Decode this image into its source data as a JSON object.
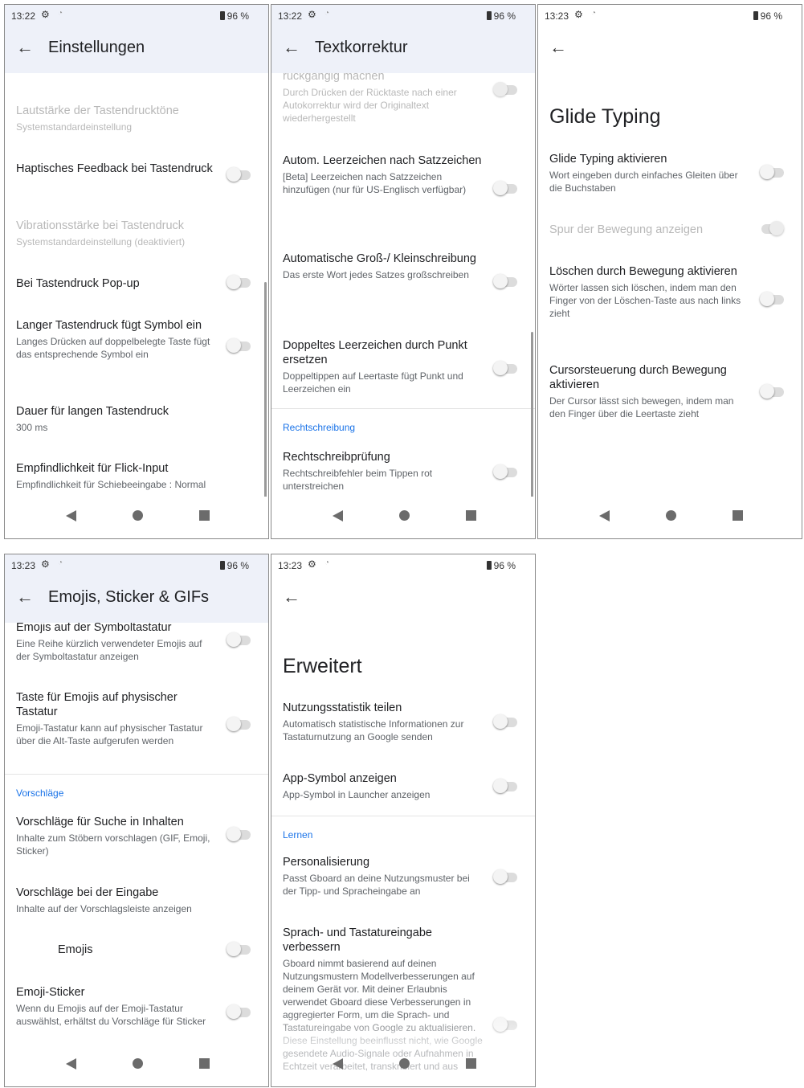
{
  "status": {
    "time_1": "13:22",
    "time_2": "13:22",
    "time_3": "13:23",
    "time_4": "13:23",
    "time_5": "13:23",
    "battery": "96 %"
  },
  "screen1": {
    "title": "Einstellungen",
    "items": [
      {
        "title": "Lautstärke der Tastendrucktöne",
        "subtitle": "Systemstandardeinstellung"
      },
      {
        "title": "Haptisches Feedback bei Tastendruck"
      },
      {
        "title": "Vibrationsstärke bei Tastendruck",
        "subtitle": "Systemstandardeinstellung (deaktiviert)"
      },
      {
        "title": "Bei Tastendruck Pop-up"
      },
      {
        "title": "Langer Tastendruck fügt Symbol ein",
        "subtitle": "Langes Drücken auf doppelbelegte Taste fügt das entsprechende Symbol ein"
      },
      {
        "title": "Dauer für langen Tastendruck",
        "subtitle": "300 ms"
      },
      {
        "title": "Empfindlichkeit für Flick-Input",
        "subtitle": "Empfindlichkeit für Schiebeeingabe : Normal"
      }
    ]
  },
  "screen2": {
    "title": "Textkorrektur",
    "items": [
      {
        "title": "rückgängig machen",
        "subtitle": "Durch Drücken der Rücktaste nach einer Autokorrektur wird der Originaltext wiederhergestellt"
      },
      {
        "title": "Autom. Leerzeichen nach Satzzeichen",
        "subtitle": "[Beta] Leerzeichen nach Satzzeichen hinzufügen (nur für US-Englisch verfügbar)"
      },
      {
        "title": "Automatische Groß-/ Kleinschreibung",
        "subtitle": "Das erste Wort jedes Satzes großschreiben"
      },
      {
        "title": "Doppeltes Leerzeichen durch Punkt ersetzen",
        "subtitle": "Doppeltippen auf Leertaste fügt Punkt und Leerzeichen ein"
      },
      {
        "title": "Rechtschreibprüfung",
        "subtitle": "Rechtschreibfehler beim Tippen rot unterstreichen"
      }
    ],
    "section": "Rechtschreibung"
  },
  "screen3": {
    "title": "Glide Typing",
    "items": [
      {
        "title": "Glide Typing aktivieren",
        "subtitle": "Wort eingeben durch einfaches Gleiten über die Buchstaben"
      },
      {
        "title": "Spur der Bewegung anzeigen"
      },
      {
        "title": "Löschen durch Bewegung aktivieren",
        "subtitle": "Wörter lassen sich löschen, indem man den Finger von der Löschen-Taste aus nach links zieht"
      },
      {
        "title": "Cursorsteuerung durch Bewegung aktivieren",
        "subtitle": "Der Cursor lässt sich bewegen, indem man den Finger über die Leertaste zieht"
      }
    ]
  },
  "screen4": {
    "title": "Emojis, Sticker & GIFs",
    "items": [
      {
        "title": "Emojis auf der Symboltastatur",
        "subtitle": "Eine Reihe kürzlich verwendeter Emojis auf der Symboltastatur anzeigen"
      },
      {
        "title": "Taste für Emojis auf physischer Tastatur",
        "subtitle": "Emoji-Tastatur kann auf physischer Tastatur über die Alt-Taste aufgerufen werden"
      },
      {
        "title": "Vorschläge für Suche in Inhalten",
        "subtitle": "Inhalte zum Stöbern vorschlagen (GIF, Emoji, Sticker)"
      },
      {
        "title": "Vorschläge bei der Eingabe",
        "subtitle": "Inhalte auf der Vorschlagsleiste anzeigen"
      },
      {
        "title": "Emojis"
      },
      {
        "title": "Emoji-Sticker",
        "subtitle": "Wenn du Emojis auf der Emoji-Tastatur auswählst, erhältst du Vorschläge für Sticker"
      }
    ],
    "section": "Vorschläge"
  },
  "screen5": {
    "title": "Erweitert",
    "items": [
      {
        "title": "Nutzungsstatistik teilen",
        "subtitle": "Automatisch statistische Informationen zur Tastaturnutzung an Google senden"
      },
      {
        "title": "App-Symbol anzeigen",
        "subtitle": "App-Symbol in Launcher anzeigen"
      },
      {
        "title": "Personalisierung",
        "subtitle": "Passt Gboard an deine Nutzungsmuster bei der Tipp- und Spracheingabe an"
      },
      {
        "title": "Sprach- und Tastatureingabe verbessern",
        "subtitle": "Gboard nimmt basierend auf deinen Nutzungsmustern Modellverbesserungen auf deinem Gerät vor. Mit deiner Erlaubnis verwendet Gboard diese Verbesserungen in aggregierter Form, um die Sprach- und Tastatureingabe von Google zu aktualisieren. Diese Einstellung beeinflusst nicht, wie Google gesendete Audio-Signale oder Aufnahmen in Echtzeit verarbeitet, transkribiert und aus"
      }
    ],
    "section": "Lernen"
  },
  "toggles": {
    "screen1": {
      "haptic": false,
      "popup": false,
      "long_press": false
    },
    "screen2": {
      "undo": false,
      "auto_space": false,
      "auto_caps": false,
      "double_space": false,
      "spell_check": false
    },
    "screen3": {
      "glide": false,
      "trail": true,
      "delete_gesture": false,
      "cursor_gesture": false
    },
    "screen4": {
      "emoji_symbols": false,
      "emoji_physical": false,
      "content_suggest": false,
      "emojis": false,
      "emoji_sticker": false
    },
    "screen5": {
      "usage_stats": false,
      "app_icon": false,
      "personalization": false,
      "improve": false
    }
  },
  "colors": {
    "appbar": "#eef1f9",
    "section": "#1a73e8",
    "toggle_off_track": "#dcdcdc"
  }
}
